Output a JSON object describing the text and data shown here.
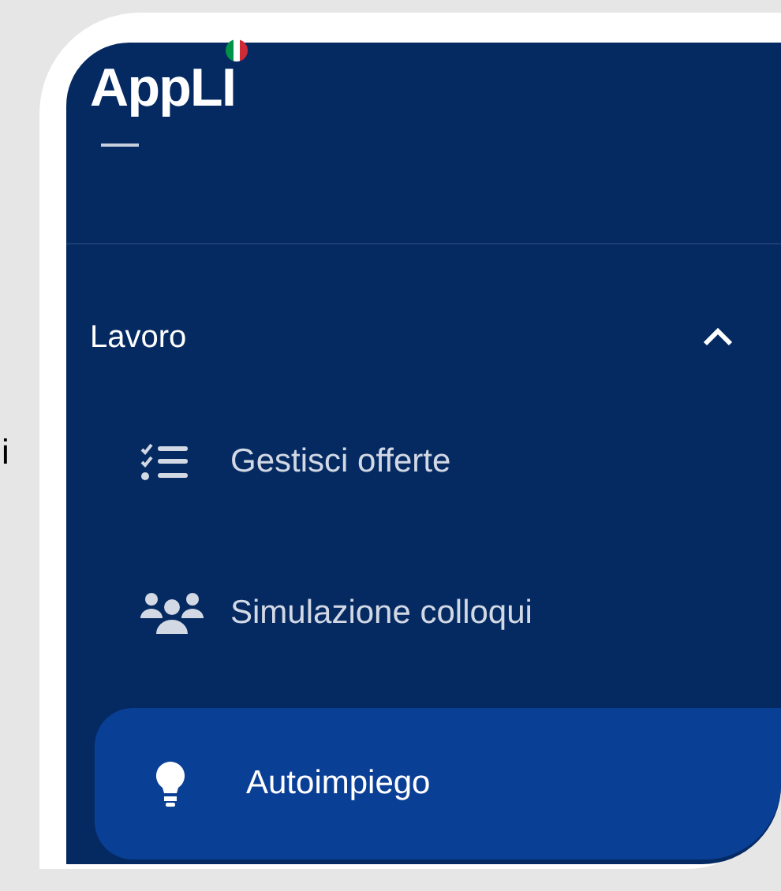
{
  "background_text": "i",
  "brand": {
    "logo": "AppLI"
  },
  "menu": {
    "section": {
      "label": "Lavoro",
      "expanded": true,
      "items": [
        {
          "kind": "checklist",
          "label": "Gestisci offerte",
          "selected": false
        },
        {
          "kind": "people",
          "label": "Simulazione colloqui",
          "selected": false
        },
        {
          "kind": "bulb",
          "label": "Autoimpiego",
          "selected": true
        }
      ]
    }
  }
}
